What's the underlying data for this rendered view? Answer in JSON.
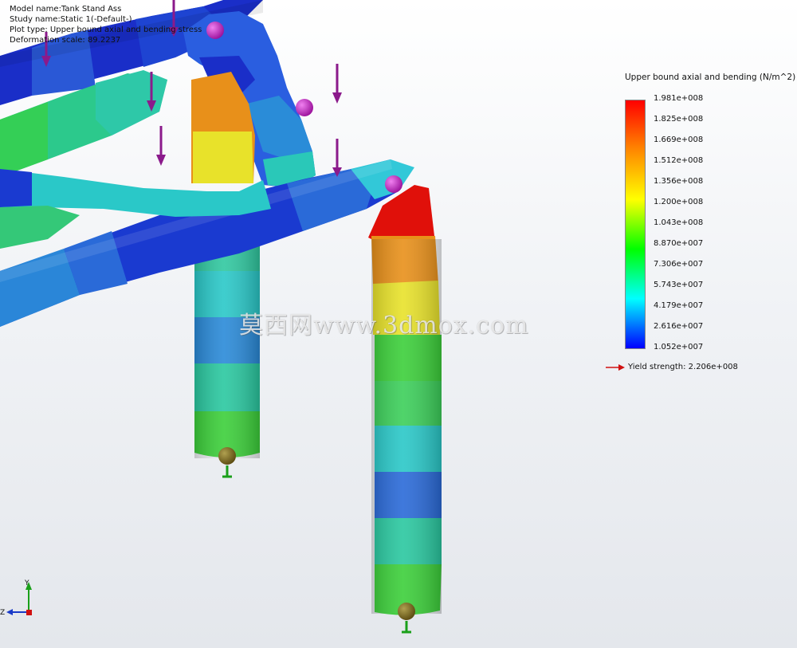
{
  "info": {
    "model_name": "Model name:Tank Stand Ass",
    "study_name": "Study name:Static 1(-Default-)",
    "plot_type": "Plot type: Upper bound axial and bending stress",
    "deformation_scale": "Deformation scale: 89.2237"
  },
  "legend": {
    "title": "Upper bound axial and bending (N/m^2)",
    "ticks": [
      "1.981e+008",
      "1.825e+008",
      "1.669e+008",
      "1.512e+008",
      "1.356e+008",
      "1.200e+008",
      "1.043e+008",
      "8.870e+007",
      "7.306e+007",
      "5.743e+007",
      "4.179e+007",
      "2.616e+007",
      "1.052e+007"
    ],
    "yield_label": "Yield strength: 2.206e+008",
    "colors": [
      "#ff0000",
      "#ff8800",
      "#ffff00",
      "#00ff00",
      "#00ffff",
      "#0000ff"
    ]
  },
  "watermark": "莫西网www.3dmox.com",
  "triad": {
    "y_label": "Y",
    "z_label": "Z"
  },
  "colors": {
    "red": "#e0100a",
    "orange": "#e8901a",
    "yellow": "#e8e22a",
    "green": "#3ccf3a",
    "teal": "#28c8b8",
    "cyan": "#32d8d8",
    "blue": "#2a6ad8",
    "darkblue": "#1a2ec8",
    "load_arrow": "#8b1a8b",
    "sphere": "#c020c0",
    "fixture": "#1aa01a",
    "yield_arrow": "#d01010"
  }
}
